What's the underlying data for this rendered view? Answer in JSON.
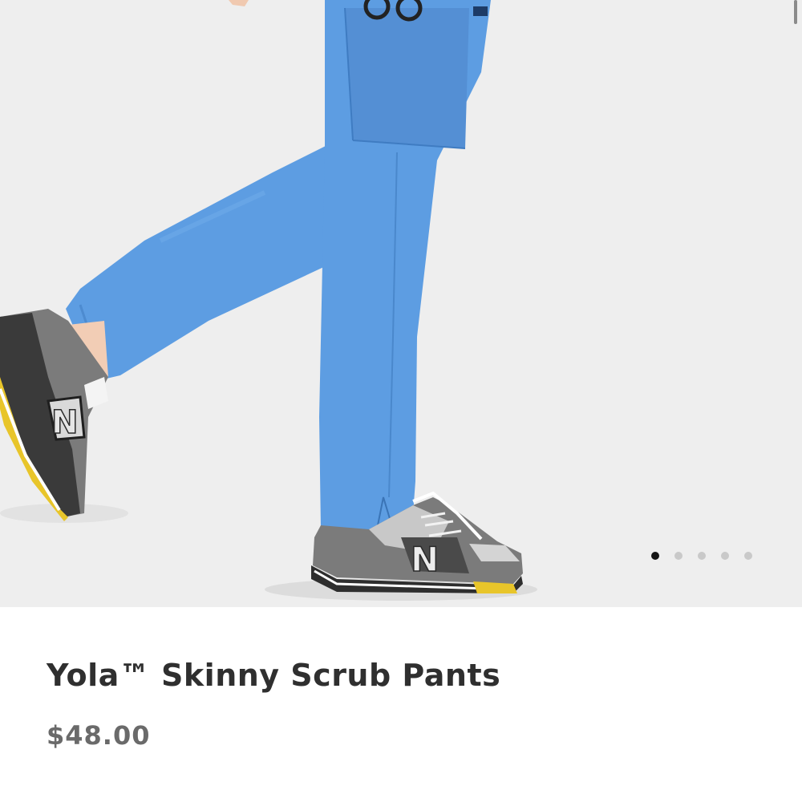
{
  "gallery": {
    "image_icon": "product-photo-blue-scrub-pants-grey-sneakers",
    "slide_count": 5,
    "active_slide": 1
  },
  "product": {
    "title": "Yola™ Skinny Scrub Pants",
    "price": "$48.00"
  },
  "colors": {
    "pants": "#5a9be0",
    "shoe_grey": "#7b7b7b",
    "sole_yellow": "#e8c52a",
    "background": "#eeeeee"
  }
}
